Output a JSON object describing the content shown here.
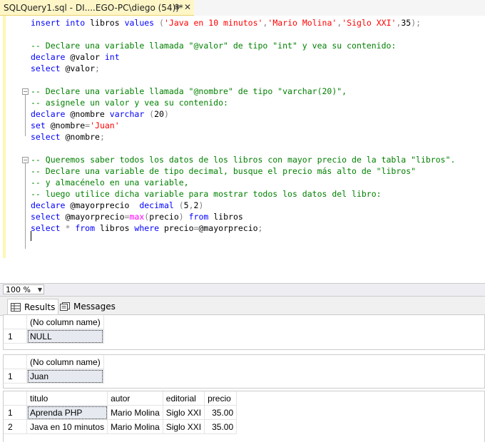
{
  "tab": {
    "title": "SQLQuery1.sql - DI....EGO-PC\\diego (54))*",
    "pin_icon": "pin-icon",
    "close_icon": "close-icon"
  },
  "code": [
    [
      [
        "kw",
        "insert into"
      ],
      [
        "",
        "libros "
      ],
      [
        "kw",
        "values"
      ],
      [
        "gy",
        "("
      ],
      [
        "st",
        "'Java en 10 minutos'"
      ],
      [
        "gy",
        ","
      ],
      [
        "st",
        "'Mario Molina'"
      ],
      [
        "gy",
        ","
      ],
      [
        "st",
        "'Siglo XXI'"
      ],
      [
        "gy",
        ","
      ],
      [
        "",
        "35"
      ],
      [
        "gy",
        ");"
      ]
    ],
    [],
    [
      [
        "cm",
        "-- Declare una variable llamada \"@valor\" de tipo \"int\" y vea su contenido:"
      ]
    ],
    [
      [
        "kw",
        "declare"
      ],
      [
        "",
        "@valor "
      ],
      [
        "kw",
        "int"
      ]
    ],
    [
      [
        "kw",
        "select"
      ],
      [
        "",
        "@valor"
      ],
      [
        "gy",
        ";"
      ]
    ],
    [],
    [
      [
        "cm",
        "-- Declare una variable llamada \"@nombre\" de tipo \"varchar(20)\","
      ]
    ],
    [
      [
        "cm",
        "-- asignele un valor y vea su contenido:"
      ]
    ],
    [
      [
        "kw",
        "declare"
      ],
      [
        "",
        "@nombre "
      ],
      [
        "kw",
        "varchar"
      ],
      [
        "gy",
        "("
      ],
      [
        "",
        "20"
      ],
      [
        "gy",
        ")"
      ]
    ],
    [
      [
        "kw",
        "set"
      ],
      [
        "",
        "@nombre"
      ],
      [
        "gy",
        "="
      ],
      [
        "st",
        "'Juan'"
      ]
    ],
    [
      [
        "kw",
        "select"
      ],
      [
        "",
        "@nombre"
      ],
      [
        "gy",
        ";"
      ]
    ],
    [],
    [
      [
        "cm",
        "-- Queremos saber todos los datos de los libros con mayor precio de la tabla \"libros\"."
      ]
    ],
    [
      [
        "cm",
        "-- Declare una variable de tipo decimal, busque el precio más alto de \"libros\""
      ]
    ],
    [
      [
        "cm",
        "-- y almacénelo en una variable,"
      ]
    ],
    [
      [
        "cm",
        "-- luego utilice dicha variable para mostrar todos los datos del libro:"
      ]
    ],
    [
      [
        "kw",
        "declare"
      ],
      [
        "",
        "@mayorprecio  "
      ],
      [
        "kw",
        "decimal"
      ],
      [
        "gy",
        "("
      ],
      [
        "",
        "5"
      ],
      [
        "gy",
        ","
      ],
      [
        "",
        "2"
      ],
      [
        "gy",
        ")"
      ]
    ],
    [
      [
        "kw",
        "select"
      ],
      [
        "",
        "@mayorprecio"
      ],
      [
        "gy",
        "="
      ],
      [
        "fn",
        "max"
      ],
      [
        "gy",
        "("
      ],
      [
        "",
        "precio"
      ],
      [
        "gy",
        ") "
      ],
      [
        "kw",
        "from"
      ],
      [
        "",
        "libros"
      ]
    ],
    [
      [
        "kw",
        "select"
      ],
      [
        "gy",
        "* "
      ],
      [
        "kw",
        "from"
      ],
      [
        "",
        "libros "
      ],
      [
        "kw",
        "where"
      ],
      [
        "",
        "precio"
      ],
      [
        "gy",
        "="
      ],
      [
        "",
        "@mayorprecio"
      ],
      [
        "gy",
        ";"
      ]
    ]
  ],
  "zoom": {
    "value": "100 %"
  },
  "result_tabs": {
    "results": "Results",
    "messages": "Messages"
  },
  "results": {
    "grid1": {
      "header": "(No column name)",
      "rows": [
        [
          "1",
          "NULL"
        ]
      ]
    },
    "grid2": {
      "header": "(No column name)",
      "rows": [
        [
          "1",
          "Juan"
        ]
      ]
    },
    "grid3": {
      "columns": [
        "titulo",
        "autor",
        "editorial",
        "precio"
      ],
      "rows": [
        [
          "1",
          "Aprenda PHP",
          "Mario Molina",
          "Siglo XXI",
          "35.00"
        ],
        [
          "2",
          "Java en 10 minutos",
          "Mario Molina",
          "Siglo XXI",
          "35.00"
        ]
      ]
    }
  }
}
